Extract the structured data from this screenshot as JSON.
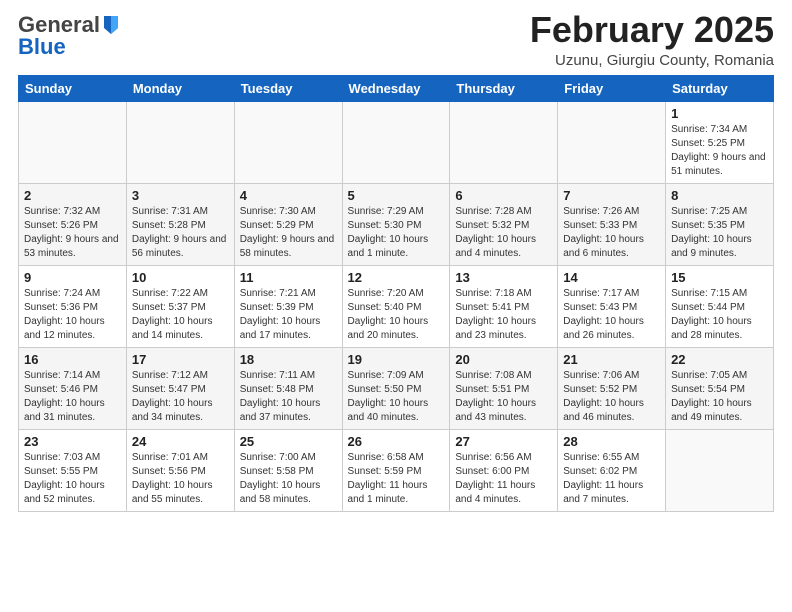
{
  "header": {
    "logo_general": "General",
    "logo_blue": "Blue",
    "month_title": "February 2025",
    "location": "Uzunu, Giurgiu County, Romania"
  },
  "weekdays": [
    "Sunday",
    "Monday",
    "Tuesday",
    "Wednesday",
    "Thursday",
    "Friday",
    "Saturday"
  ],
  "weeks": [
    [
      {
        "day": "",
        "info": ""
      },
      {
        "day": "",
        "info": ""
      },
      {
        "day": "",
        "info": ""
      },
      {
        "day": "",
        "info": ""
      },
      {
        "day": "",
        "info": ""
      },
      {
        "day": "",
        "info": ""
      },
      {
        "day": "1",
        "info": "Sunrise: 7:34 AM\nSunset: 5:25 PM\nDaylight: 9 hours and 51 minutes."
      }
    ],
    [
      {
        "day": "2",
        "info": "Sunrise: 7:32 AM\nSunset: 5:26 PM\nDaylight: 9 hours and 53 minutes."
      },
      {
        "day": "3",
        "info": "Sunrise: 7:31 AM\nSunset: 5:28 PM\nDaylight: 9 hours and 56 minutes."
      },
      {
        "day": "4",
        "info": "Sunrise: 7:30 AM\nSunset: 5:29 PM\nDaylight: 9 hours and 58 minutes."
      },
      {
        "day": "5",
        "info": "Sunrise: 7:29 AM\nSunset: 5:30 PM\nDaylight: 10 hours and 1 minute."
      },
      {
        "day": "6",
        "info": "Sunrise: 7:28 AM\nSunset: 5:32 PM\nDaylight: 10 hours and 4 minutes."
      },
      {
        "day": "7",
        "info": "Sunrise: 7:26 AM\nSunset: 5:33 PM\nDaylight: 10 hours and 6 minutes."
      },
      {
        "day": "8",
        "info": "Sunrise: 7:25 AM\nSunset: 5:35 PM\nDaylight: 10 hours and 9 minutes."
      }
    ],
    [
      {
        "day": "9",
        "info": "Sunrise: 7:24 AM\nSunset: 5:36 PM\nDaylight: 10 hours and 12 minutes."
      },
      {
        "day": "10",
        "info": "Sunrise: 7:22 AM\nSunset: 5:37 PM\nDaylight: 10 hours and 14 minutes."
      },
      {
        "day": "11",
        "info": "Sunrise: 7:21 AM\nSunset: 5:39 PM\nDaylight: 10 hours and 17 minutes."
      },
      {
        "day": "12",
        "info": "Sunrise: 7:20 AM\nSunset: 5:40 PM\nDaylight: 10 hours and 20 minutes."
      },
      {
        "day": "13",
        "info": "Sunrise: 7:18 AM\nSunset: 5:41 PM\nDaylight: 10 hours and 23 minutes."
      },
      {
        "day": "14",
        "info": "Sunrise: 7:17 AM\nSunset: 5:43 PM\nDaylight: 10 hours and 26 minutes."
      },
      {
        "day": "15",
        "info": "Sunrise: 7:15 AM\nSunset: 5:44 PM\nDaylight: 10 hours and 28 minutes."
      }
    ],
    [
      {
        "day": "16",
        "info": "Sunrise: 7:14 AM\nSunset: 5:46 PM\nDaylight: 10 hours and 31 minutes."
      },
      {
        "day": "17",
        "info": "Sunrise: 7:12 AM\nSunset: 5:47 PM\nDaylight: 10 hours and 34 minutes."
      },
      {
        "day": "18",
        "info": "Sunrise: 7:11 AM\nSunset: 5:48 PM\nDaylight: 10 hours and 37 minutes."
      },
      {
        "day": "19",
        "info": "Sunrise: 7:09 AM\nSunset: 5:50 PM\nDaylight: 10 hours and 40 minutes."
      },
      {
        "day": "20",
        "info": "Sunrise: 7:08 AM\nSunset: 5:51 PM\nDaylight: 10 hours and 43 minutes."
      },
      {
        "day": "21",
        "info": "Sunrise: 7:06 AM\nSunset: 5:52 PM\nDaylight: 10 hours and 46 minutes."
      },
      {
        "day": "22",
        "info": "Sunrise: 7:05 AM\nSunset: 5:54 PM\nDaylight: 10 hours and 49 minutes."
      }
    ],
    [
      {
        "day": "23",
        "info": "Sunrise: 7:03 AM\nSunset: 5:55 PM\nDaylight: 10 hours and 52 minutes."
      },
      {
        "day": "24",
        "info": "Sunrise: 7:01 AM\nSunset: 5:56 PM\nDaylight: 10 hours and 55 minutes."
      },
      {
        "day": "25",
        "info": "Sunrise: 7:00 AM\nSunset: 5:58 PM\nDaylight: 10 hours and 58 minutes."
      },
      {
        "day": "26",
        "info": "Sunrise: 6:58 AM\nSunset: 5:59 PM\nDaylight: 11 hours and 1 minute."
      },
      {
        "day": "27",
        "info": "Sunrise: 6:56 AM\nSunset: 6:00 PM\nDaylight: 11 hours and 4 minutes."
      },
      {
        "day": "28",
        "info": "Sunrise: 6:55 AM\nSunset: 6:02 PM\nDaylight: 11 hours and 7 minutes."
      },
      {
        "day": "",
        "info": ""
      }
    ]
  ]
}
